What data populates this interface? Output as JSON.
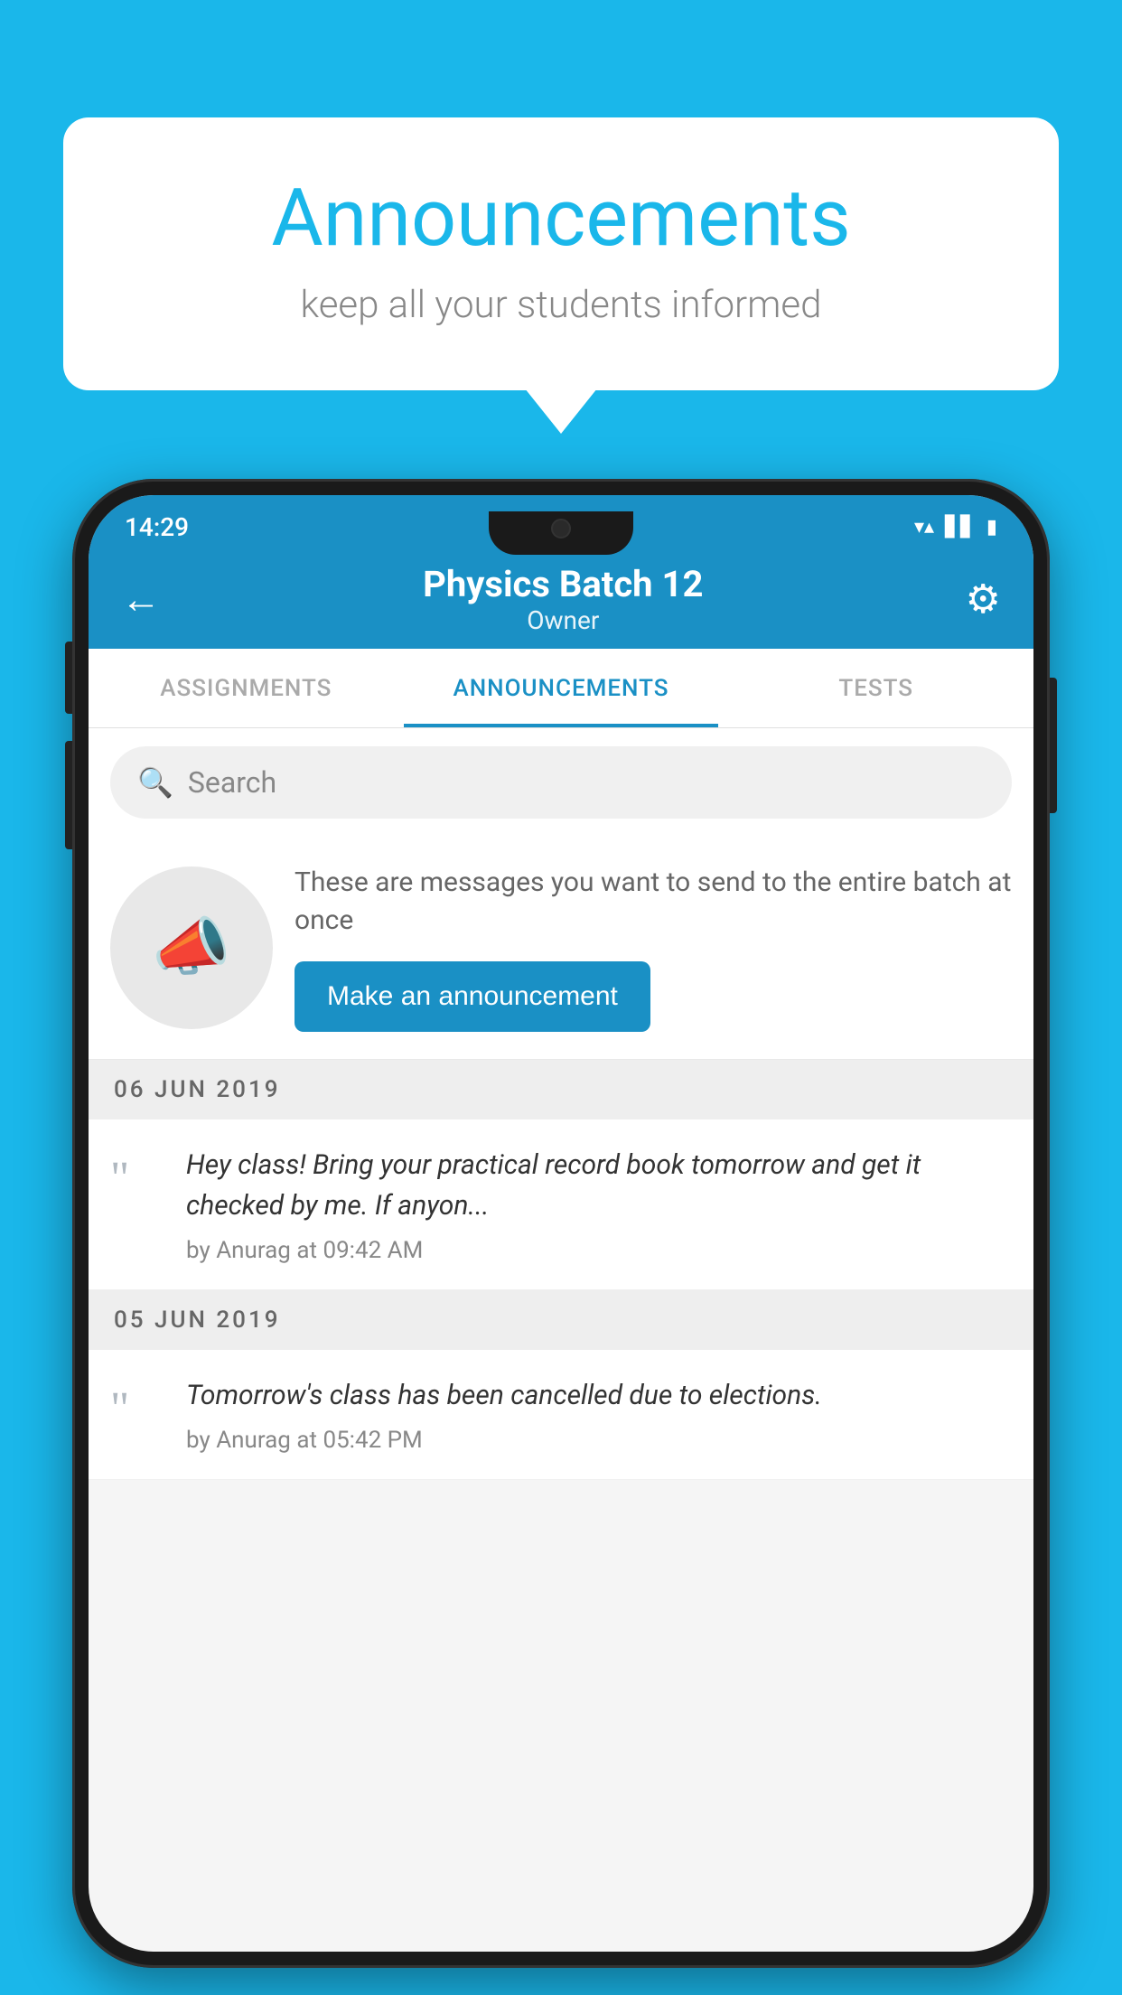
{
  "background_color": "#1ab7ea",
  "speech_bubble": {
    "title": "Announcements",
    "subtitle": "keep all your students informed"
  },
  "status_bar": {
    "time": "14:29",
    "icons": [
      "wifi",
      "signal",
      "battery"
    ]
  },
  "app_bar": {
    "title": "Physics Batch 12",
    "subtitle": "Owner",
    "back_label": "←",
    "gear_label": "⚙"
  },
  "tabs": [
    {
      "label": "ASSIGNMENTS",
      "active": false
    },
    {
      "label": "ANNOUNCEMENTS",
      "active": true
    },
    {
      "label": "TESTS",
      "active": false
    }
  ],
  "search": {
    "placeholder": "Search"
  },
  "promo": {
    "description": "These are messages you want to send to the entire batch at once",
    "button_label": "Make an announcement"
  },
  "date_sections": [
    {
      "date": "06  JUN  2019",
      "announcements": [
        {
          "text": "Hey class! Bring your practical record book tomorrow and get it checked by me. If anyon...",
          "meta": "by Anurag at 09:42 AM"
        }
      ]
    },
    {
      "date": "05  JUN  2019",
      "announcements": [
        {
          "text": "Tomorrow's class has been cancelled due to elections.",
          "meta": "by Anurag at 05:42 PM"
        }
      ]
    }
  ]
}
